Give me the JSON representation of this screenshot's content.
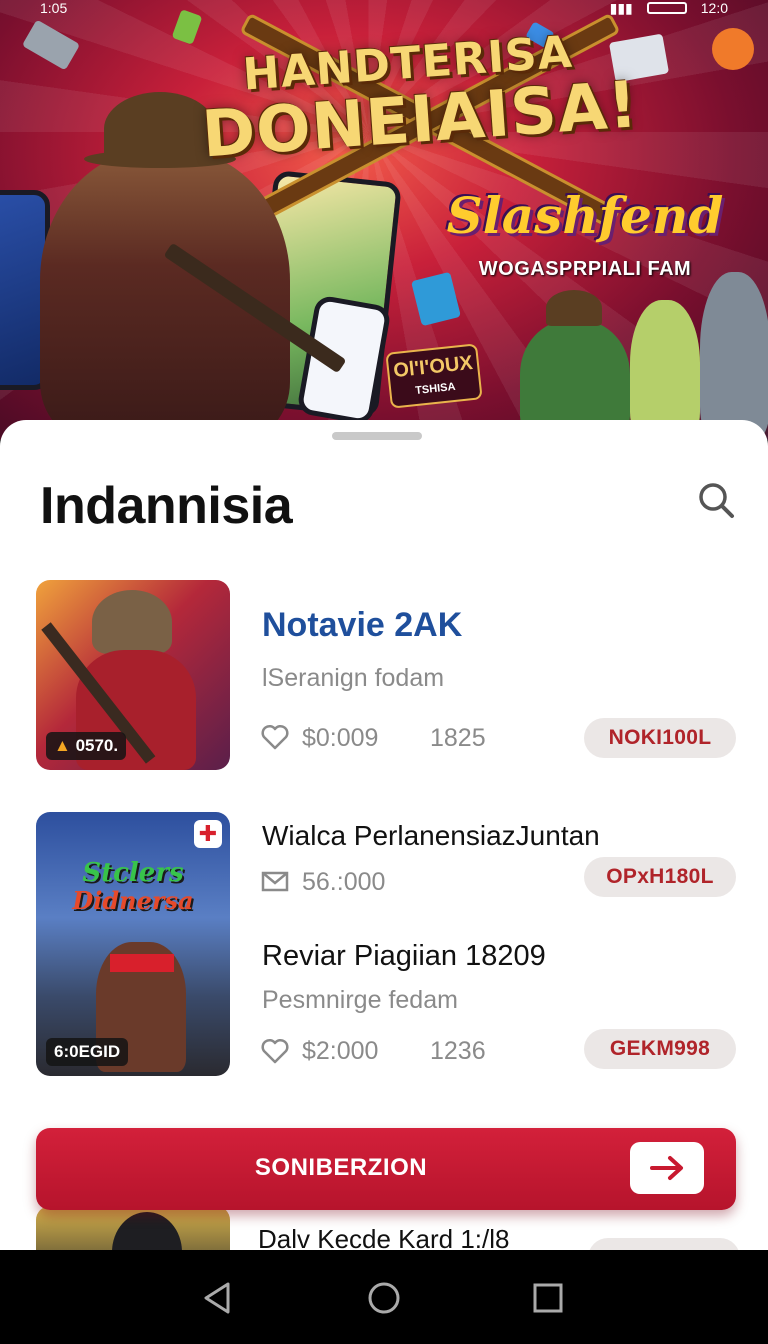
{
  "status_bar": {
    "time": "1:05",
    "clock_right": "12:0"
  },
  "hero": {
    "title_line1": "HANDTERISA",
    "title_line2": "DONEIAISA!",
    "sub_logo": "Slashfend",
    "sub_tag": "WOGASPRPIALI FAM",
    "badge_main": "Ol'I'OUX",
    "badge_small": "TSHISA"
  },
  "sheet": {
    "title": "Indannisia"
  },
  "items": [
    {
      "title": "Notavie 2AK",
      "subtitle": "lSeranign fodam",
      "price": "$0:009",
      "count": "1825",
      "pill": "NOKI100L",
      "thumb_badge": "0570."
    },
    {
      "title": "Wialca PerlanensiazJuntan",
      "price": "56.:000",
      "pill": "OPxH180L",
      "thumb_badge": "6:0EGID",
      "thumb_logo_l1": "Stclers",
      "thumb_logo_l2": "Didnersa"
    },
    {
      "title": "Reviar Piagiian 18209",
      "subtitle": "Pesmnirge fedam",
      "price": "$2:000",
      "count": "1236",
      "pill": "GEKM998"
    },
    {
      "title": "Dalv Kecde Kard 1:/l8"
    }
  ],
  "cta": {
    "label": "SONIBERZION"
  },
  "colors": {
    "accent": "#c8192f",
    "title_blue": "#1f4f9c",
    "pill_text": "#b0242a"
  }
}
